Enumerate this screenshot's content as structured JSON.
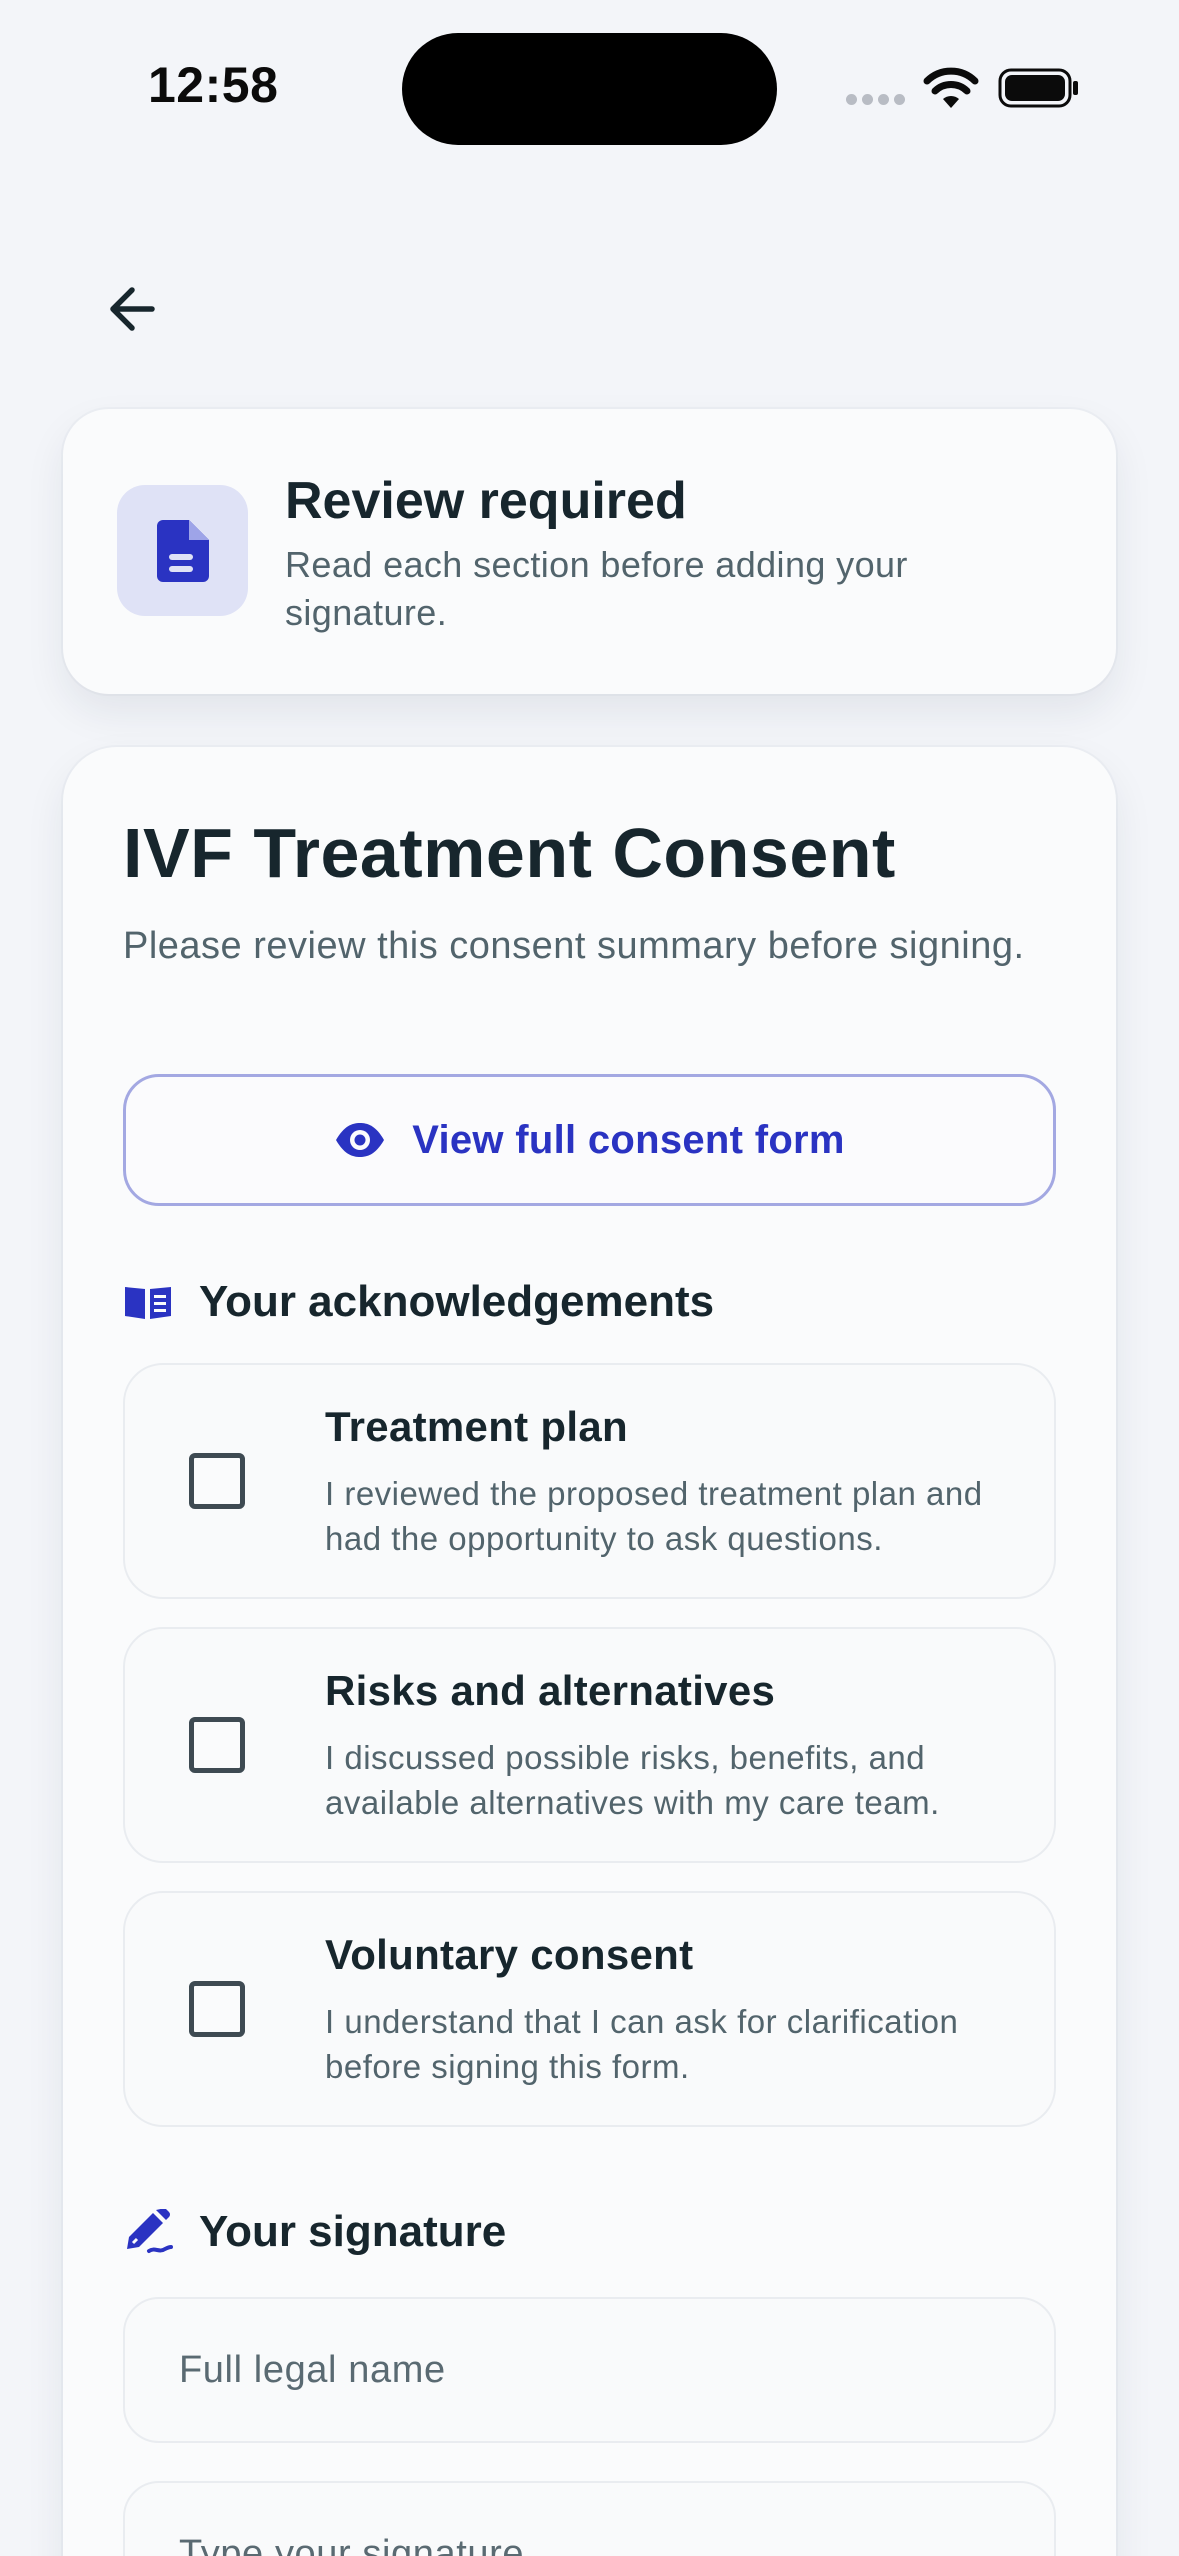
{
  "status": {
    "time": "12:58"
  },
  "banner": {
    "title": "Review required",
    "subtitle": "Read each section before adding your signature."
  },
  "consent": {
    "title": "IVF Treatment Consent",
    "subtitle": "Please review this consent summary before signing.",
    "view_button": "View full consent form"
  },
  "acknowledgements": {
    "heading": "Your acknowledgements",
    "items": [
      {
        "title": "Treatment plan",
        "description": "I reviewed the proposed treatment plan and had the opportunity to ask questions.",
        "checked": false
      },
      {
        "title": "Risks and alternatives",
        "description": "I discussed possible risks, benefits, and available alternatives with my care team.",
        "checked": false
      },
      {
        "title": "Voluntary consent",
        "description": "I understand that I can ask for clarification before signing this form.",
        "checked": false
      }
    ]
  },
  "signature": {
    "heading": "Your signature",
    "name_placeholder": "Full legal name",
    "signature_placeholder": "Type your signature"
  },
  "colors": {
    "accent": "#2a33c2",
    "accent_light": "#dfe2f6",
    "text": "#17262d",
    "muted": "#52646c",
    "background": "#f3f5f9"
  }
}
